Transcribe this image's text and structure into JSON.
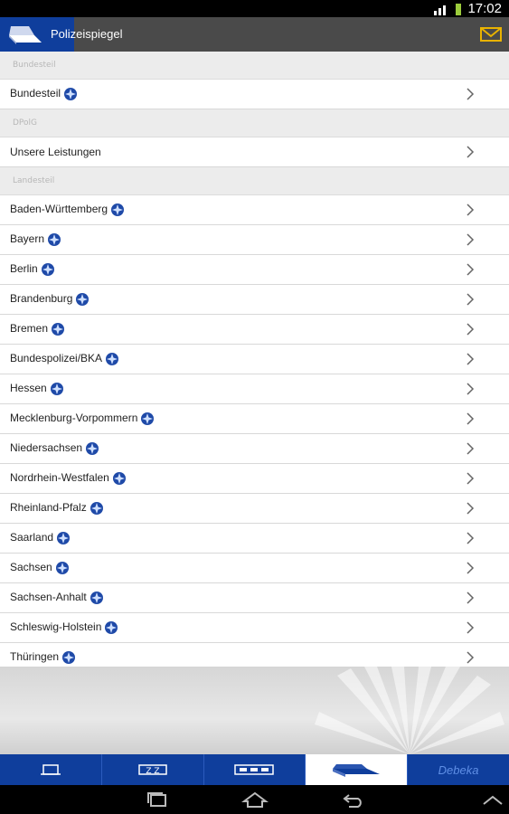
{
  "status": {
    "time": "17:02"
  },
  "app": {
    "title": "Polizeispiegel"
  },
  "sections": [
    {
      "header": "Bundesteil",
      "items": [
        {
          "label": "Bundesteil",
          "badge": true
        }
      ]
    },
    {
      "header": "DPolG",
      "items": [
        {
          "label": "Unsere Leistungen",
          "badge": false
        }
      ]
    },
    {
      "header": "Landesteil",
      "items": [
        {
          "label": "Baden-Württemberg",
          "badge": true
        },
        {
          "label": "Bayern",
          "badge": true
        },
        {
          "label": "Berlin",
          "badge": true
        },
        {
          "label": "Brandenburg",
          "badge": true
        },
        {
          "label": "Bremen",
          "badge": true
        },
        {
          "label": "Bundespolizei/BKA",
          "badge": true
        },
        {
          "label": "Hessen",
          "badge": true
        },
        {
          "label": "Mecklenburg-Vorpommern",
          "badge": true
        },
        {
          "label": "Niedersachsen",
          "badge": true
        },
        {
          "label": "Nordrhein-Westfalen",
          "badge": true
        },
        {
          "label": "Rheinland-Pfalz",
          "badge": true
        },
        {
          "label": "Saarland",
          "badge": true
        },
        {
          "label": "Sachsen",
          "badge": true
        },
        {
          "label": "Sachsen-Anhalt",
          "badge": true
        },
        {
          "label": "Schleswig-Holstein",
          "badge": true
        },
        {
          "label": "Thüringen",
          "badge": true
        }
      ]
    }
  ],
  "tabs": [
    {
      "name": "tab-news",
      "icon": "newspaper-icon"
    },
    {
      "name": "tab-calendar",
      "icon": "calendar-icon"
    },
    {
      "name": "tab-list",
      "icon": "list-icon"
    },
    {
      "name": "tab-polizeispiegel",
      "icon": "magazine-icon",
      "active": true
    },
    {
      "name": "tab-debeka",
      "text": "Debeka"
    }
  ],
  "colors": {
    "brand": "#0f3e9c",
    "appbar": "#4a4a4a",
    "badge": "#1f4aa8"
  }
}
